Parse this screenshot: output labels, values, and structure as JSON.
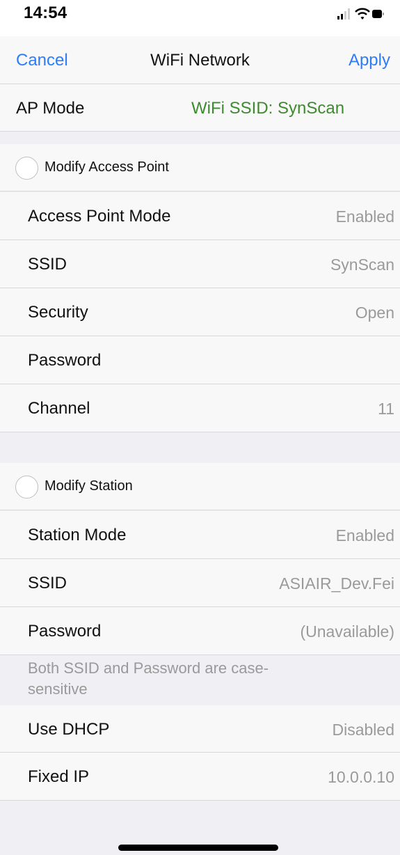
{
  "status_bar": {
    "time": "14:54"
  },
  "nav": {
    "cancel": "Cancel",
    "title": "WiFi Network",
    "apply": "Apply"
  },
  "ap_mode": {
    "label": "AP Mode",
    "value": "WiFi SSID: SynScan"
  },
  "access_point": {
    "section_label": "Modify Access Point",
    "rows": [
      {
        "label": "Access Point Mode",
        "value": "Enabled"
      },
      {
        "label": "SSID",
        "value": "SynScan"
      },
      {
        "label": "Security",
        "value": "Open"
      },
      {
        "label": "Password",
        "value": ""
      },
      {
        "label": "Channel",
        "value": "11"
      }
    ]
  },
  "station": {
    "section_label": "Modify Station",
    "rows": [
      {
        "label": "Station Mode",
        "value": "Enabled"
      },
      {
        "label": "SSID",
        "value": "ASIAIR_Dev.Fei"
      },
      {
        "label": "Password",
        "value": "(Unavailable)"
      }
    ],
    "note": "Both SSID and Password are case-sensitive",
    "rows2": [
      {
        "label": "Use DHCP",
        "value": "Disabled"
      },
      {
        "label": "Fixed IP",
        "value": "10.0.0.10"
      }
    ]
  }
}
